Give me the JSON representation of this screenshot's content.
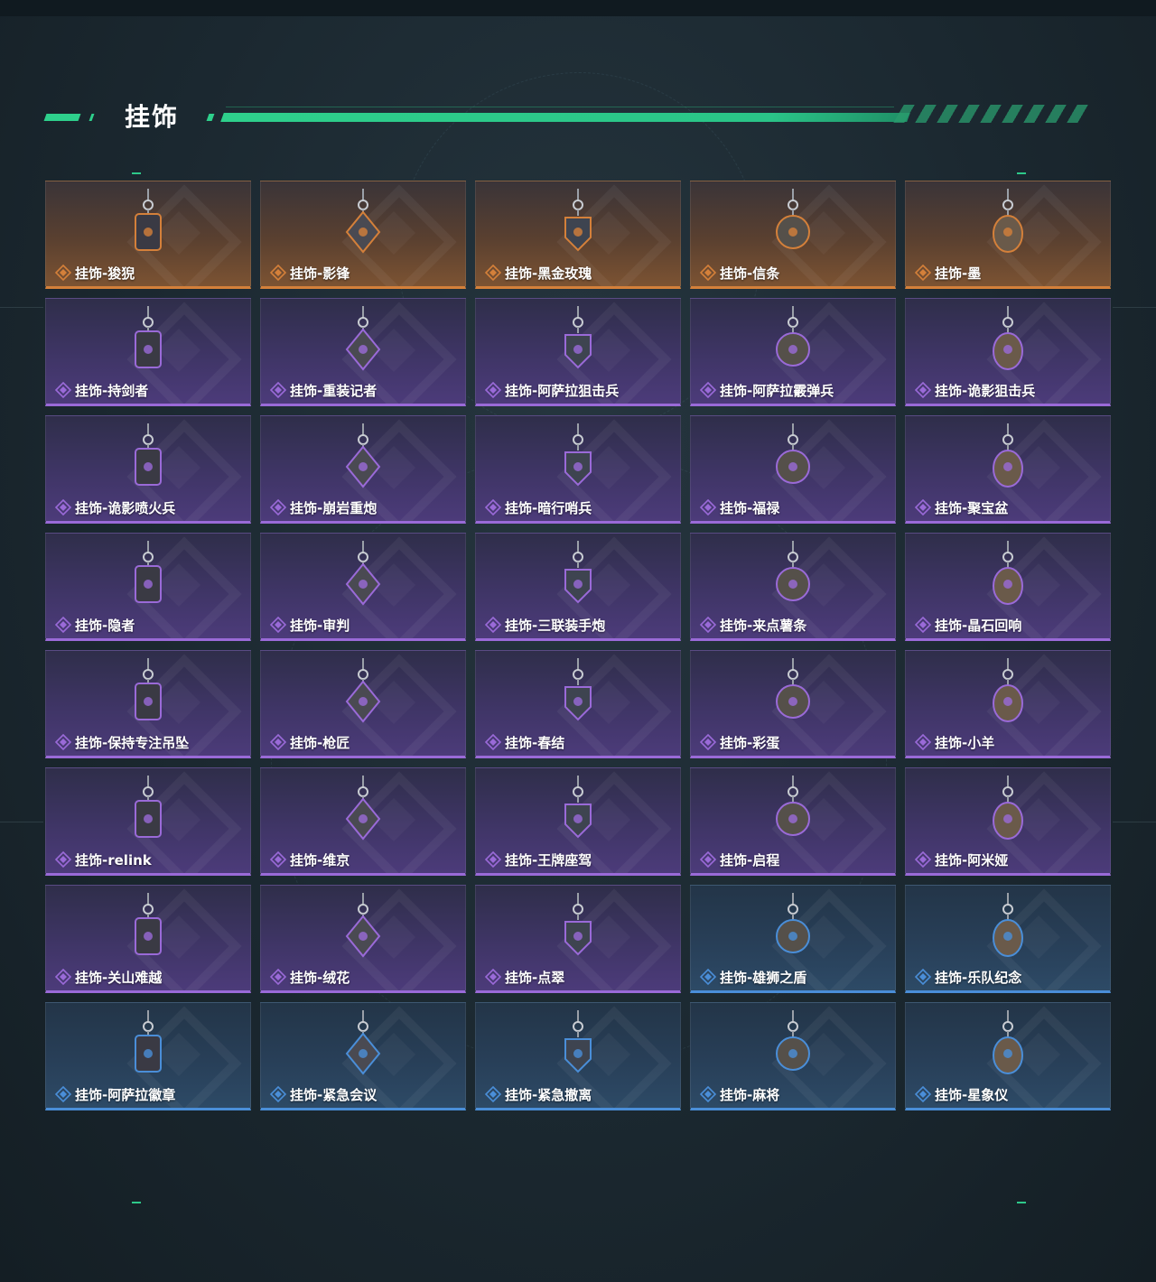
{
  "section": {
    "title": "挂饰"
  },
  "rarity_colors": {
    "orange": "#d4803a",
    "purple": "#9a6ad8",
    "blue": "#4a8ed8"
  },
  "items": [
    {
      "name": "挂饰-狻猊",
      "rarity": "orange",
      "icon": "purple-lion-charm-icon"
    },
    {
      "name": "挂饰-影锋",
      "rarity": "orange",
      "icon": "dagger-charm-icon"
    },
    {
      "name": "挂饰-黑金玫瑰",
      "rarity": "orange",
      "icon": "black-gold-rose-charm-icon"
    },
    {
      "name": "挂饰-信条",
      "rarity": "orange",
      "icon": "creed-charm-icon"
    },
    {
      "name": "挂饰-墨",
      "rarity": "orange",
      "icon": "ink-tag-charm-icon"
    },
    {
      "name": "挂饰-持剑者",
      "rarity": "purple",
      "icon": "knight-figure-charm-icon"
    },
    {
      "name": "挂饰-重装记者",
      "rarity": "purple",
      "icon": "reporter-figure-charm-icon"
    },
    {
      "name": "挂饰-阿萨拉狙击兵",
      "rarity": "purple",
      "icon": "sniper-figure-charm-icon"
    },
    {
      "name": "挂饰-阿萨拉霰弹兵",
      "rarity": "purple",
      "icon": "shotgunner-figure-charm-icon"
    },
    {
      "name": "挂饰-诡影狙击兵",
      "rarity": "purple",
      "icon": "shadow-sniper-figure-charm-icon"
    },
    {
      "name": "挂饰-诡影喷火兵",
      "rarity": "purple",
      "icon": "flamethrower-figure-charm-icon"
    },
    {
      "name": "挂饰-崩岩重炮",
      "rarity": "purple",
      "icon": "heavy-gunner-figure-charm-icon"
    },
    {
      "name": "挂饰-暗行哨兵",
      "rarity": "purple",
      "icon": "sentry-figure-charm-icon"
    },
    {
      "name": "挂饰-福禄",
      "rarity": "purple",
      "icon": "gourd-charm-icon"
    },
    {
      "name": "挂饰-聚宝盆",
      "rarity": "purple",
      "icon": "treasure-bowl-charm-icon"
    },
    {
      "name": "挂饰-隐者",
      "rarity": "purple",
      "icon": "hermit-card-charm-icon"
    },
    {
      "name": "挂饰-审判",
      "rarity": "purple",
      "icon": "judgement-card-charm-icon"
    },
    {
      "name": "挂饰-三联装手炮",
      "rarity": "purple",
      "icon": "hand-cannon-charm-icon"
    },
    {
      "name": "挂饰-来点薯条",
      "rarity": "purple",
      "icon": "fries-charm-icon"
    },
    {
      "name": "挂饰-晶石回响",
      "rarity": "purple",
      "icon": "crystal-charm-icon"
    },
    {
      "name": "挂饰-保持专注吊坠",
      "rarity": "purple",
      "icon": "stay-focused-tag-icon"
    },
    {
      "name": "挂饰-枪匠",
      "rarity": "purple",
      "icon": "gunsmith-charm-icon"
    },
    {
      "name": "挂饰-春结",
      "rarity": "purple",
      "icon": "chinese-knot-charm-icon"
    },
    {
      "name": "挂饰-彩蛋",
      "rarity": "purple",
      "icon": "easter-egg-charm-icon"
    },
    {
      "name": "挂饰-小羊",
      "rarity": "purple",
      "icon": "lamb-charm-icon"
    },
    {
      "name": "挂饰-relink",
      "rarity": "purple",
      "icon": "relink-charm-icon"
    },
    {
      "name": "挂饰-维京",
      "rarity": "purple",
      "icon": "viking-hammer-charm-icon"
    },
    {
      "name": "挂饰-王牌座驾",
      "rarity": "purple",
      "icon": "jet-plane-charm-icon"
    },
    {
      "name": "挂饰-启程",
      "rarity": "purple",
      "icon": "compass-badge-charm-icon"
    },
    {
      "name": "挂饰-阿米娅",
      "rarity": "purple",
      "icon": "amiya-charm-icon"
    },
    {
      "name": "挂饰-关山难越",
      "rarity": "purple",
      "icon": "yellow-capsule-charm-icon"
    },
    {
      "name": "挂饰-绒花",
      "rarity": "purple",
      "icon": "velvet-flower-charm-icon"
    },
    {
      "name": "挂饰-点翠",
      "rarity": "purple",
      "icon": "kingfisher-charm-icon"
    },
    {
      "name": "挂饰-雄狮之盾",
      "rarity": "blue",
      "icon": "lion-shield-charm-icon"
    },
    {
      "name": "挂饰-乐队纪念",
      "rarity": "blue",
      "icon": "band-badge-charm-icon"
    },
    {
      "name": "挂饰-阿萨拉徽章",
      "rarity": "blue",
      "icon": "ahsarah-medal-charm-icon"
    },
    {
      "name": "挂饰-紧急会议",
      "rarity": "blue",
      "icon": "emergency-meeting-charm-icon"
    },
    {
      "name": "挂饰-紧急撤离",
      "rarity": "blue",
      "icon": "emergency-exit-charm-icon"
    },
    {
      "name": "挂饰-麻将",
      "rarity": "blue",
      "icon": "mahjong-tile-charm-icon"
    },
    {
      "name": "挂饰-星象仪",
      "rarity": "blue",
      "icon": "astrolabe-charm-icon"
    }
  ]
}
